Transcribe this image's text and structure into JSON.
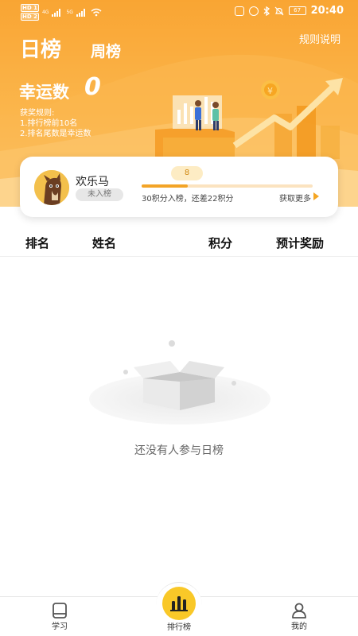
{
  "status_bar": {
    "hd1": "HD 1",
    "hd2": "HD 2",
    "network1": "4G",
    "network2": "5G",
    "battery": "67",
    "time": "20:40"
  },
  "header": {
    "tab_day": "日榜",
    "tab_week": "周榜",
    "rules_link": "规则说明",
    "lucky_label": "幸运数",
    "lucky_number": "0",
    "prize_rules_title": "获奖规则:",
    "prize_rule_1": "1.排行榜前10名",
    "prize_rule_2": "2.排名尾数是幸运数"
  },
  "user_card": {
    "name": "欢乐马",
    "rank_status": "未入榜",
    "points": "8",
    "progress_fraction": 0.27,
    "progress_text": "30积分入榜，还差22积分",
    "more_link": "获取更多"
  },
  "table": {
    "columns": [
      "排名",
      "姓名",
      "积分",
      "预计奖励"
    ]
  },
  "empty_state": {
    "message": "还没有人参与日榜"
  },
  "bottom_nav": {
    "items": [
      {
        "label": "学习",
        "icon": "book-icon"
      },
      {
        "label": "排行榜",
        "icon": "bar-chart-icon"
      },
      {
        "label": "我的",
        "icon": "user-icon"
      }
    ]
  },
  "colors": {
    "accent_orange": "#f9a533",
    "nav_yellow": "#f9c828"
  }
}
